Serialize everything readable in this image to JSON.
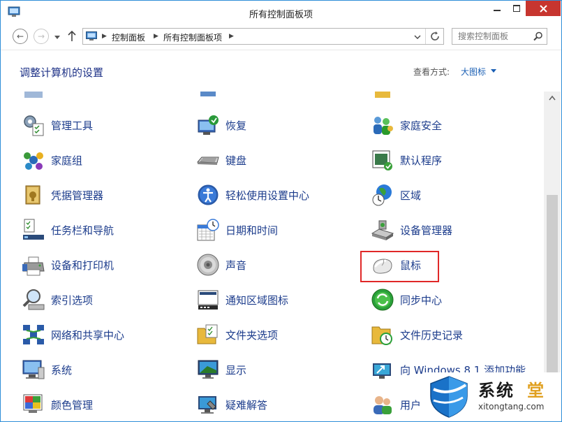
{
  "window": {
    "title": "所有控制面板项",
    "colors": {
      "close_button": "#c7352f",
      "link_text": "#1c3c8c",
      "highlight_box": "#e02828"
    }
  },
  "address_bar": {
    "breadcrumbs": [
      "控制面板",
      "所有控制面板项"
    ],
    "search_placeholder": "搜索控制面板"
  },
  "header": {
    "title": "调整计算机的设置",
    "view_by_label": "查看方式:",
    "view_by_value": "大图标"
  },
  "items": [
    {
      "label": "管理工具",
      "icon": "admin-tools-icon"
    },
    {
      "label": "恢复",
      "icon": "recovery-icon"
    },
    {
      "label": "家庭安全",
      "icon": "family-safety-icon"
    },
    {
      "label": "家庭组",
      "icon": "homegroup-icon"
    },
    {
      "label": "键盘",
      "icon": "keyboard-icon"
    },
    {
      "label": "默认程序",
      "icon": "default-programs-icon"
    },
    {
      "label": "凭据管理器",
      "icon": "credential-manager-icon"
    },
    {
      "label": "轻松使用设置中心",
      "icon": "ease-of-access-icon"
    },
    {
      "label": "区域",
      "icon": "region-icon"
    },
    {
      "label": "任务栏和导航",
      "icon": "taskbar-icon"
    },
    {
      "label": "日期和时间",
      "icon": "date-time-icon"
    },
    {
      "label": "设备管理器",
      "icon": "device-manager-icon"
    },
    {
      "label": "设备和打印机",
      "icon": "devices-printers-icon"
    },
    {
      "label": "声音",
      "icon": "sound-icon"
    },
    {
      "label": "鼠标",
      "icon": "mouse-icon"
    },
    {
      "label": "索引选项",
      "icon": "indexing-icon"
    },
    {
      "label": "通知区域图标",
      "icon": "notification-icons-icon"
    },
    {
      "label": "同步中心",
      "icon": "sync-center-icon"
    },
    {
      "label": "网络和共享中心",
      "icon": "network-icon"
    },
    {
      "label": "文件夹选项",
      "icon": "folder-options-icon"
    },
    {
      "label": "文件历史记录",
      "icon": "file-history-icon"
    },
    {
      "label": "系统",
      "icon": "system-icon"
    },
    {
      "label": "显示",
      "icon": "display-icon"
    },
    {
      "label": "向 Windows 8.1 添加功能",
      "icon": "add-features-icon"
    },
    {
      "label": "颜色管理",
      "icon": "color-management-icon"
    },
    {
      "label": "疑难解答",
      "icon": "troubleshooting-icon"
    },
    {
      "label": "用户",
      "icon": "user-accounts-icon"
    }
  ],
  "watermark": {
    "title": "系统",
    "title_accent": "堂",
    "url": "xitongtang.com"
  }
}
